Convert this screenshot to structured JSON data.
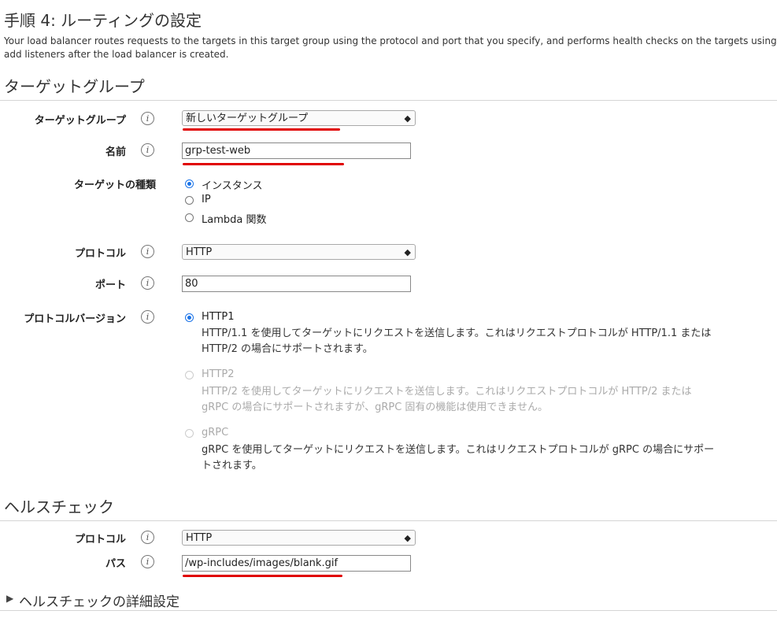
{
  "step_title": "手順 4: ルーティングの設定",
  "description": "Your load balancer routes requests to the targets in this target group using the protocol and port that you specify, and performs health checks on the targets using add listeners after the load balancer is created.",
  "target_group_section": {
    "title": "ターゲットグループ",
    "target_group_label": "ターゲットグループ",
    "target_group_value": "新しいターゲットグループ",
    "name_label": "名前",
    "name_value": "grp-test-web",
    "target_type_label": "ターゲットの種類",
    "target_type_options": [
      "インスタンス",
      "IP",
      "Lambda 関数"
    ],
    "protocol_label": "プロトコル",
    "protocol_value": "HTTP",
    "port_label": "ポート",
    "port_value": "80",
    "protocol_version_label": "プロトコルバージョン",
    "protocol_versions": [
      {
        "name": "HTTP1",
        "desc": "HTTP/1.1 を使用してターゲットにリクエストを送信します。これはリクエストプロトコルが HTTP/1.1 または HTTP/2 の場合にサポートされます。"
      },
      {
        "name": "HTTP2",
        "desc": "HTTP/2 を使用してターゲットにリクエストを送信します。これはリクエストプロトコルが HTTP/2 または gRPC の場合にサポートされますが、gRPC 固有の機能は使用できません。"
      },
      {
        "name": "gRPC",
        "desc": "gRPC を使用してターゲットにリクエストを送信します。これはリクエストプロトコルが gRPC の場合にサポートされます。"
      }
    ]
  },
  "health_check_section": {
    "title": "ヘルスチェック",
    "protocol_label": "プロトコル",
    "protocol_value": "HTTP",
    "path_label": "パス",
    "path_value": "/wp-includes/images/blank.gif",
    "advanced_label": "ヘルスチェックの詳細設定"
  },
  "info_glyph": "i",
  "select_caret": "◆",
  "disclosure_glyph": "▶",
  "colors": {
    "accent": "#1a73e8",
    "underline": "#e00000"
  }
}
